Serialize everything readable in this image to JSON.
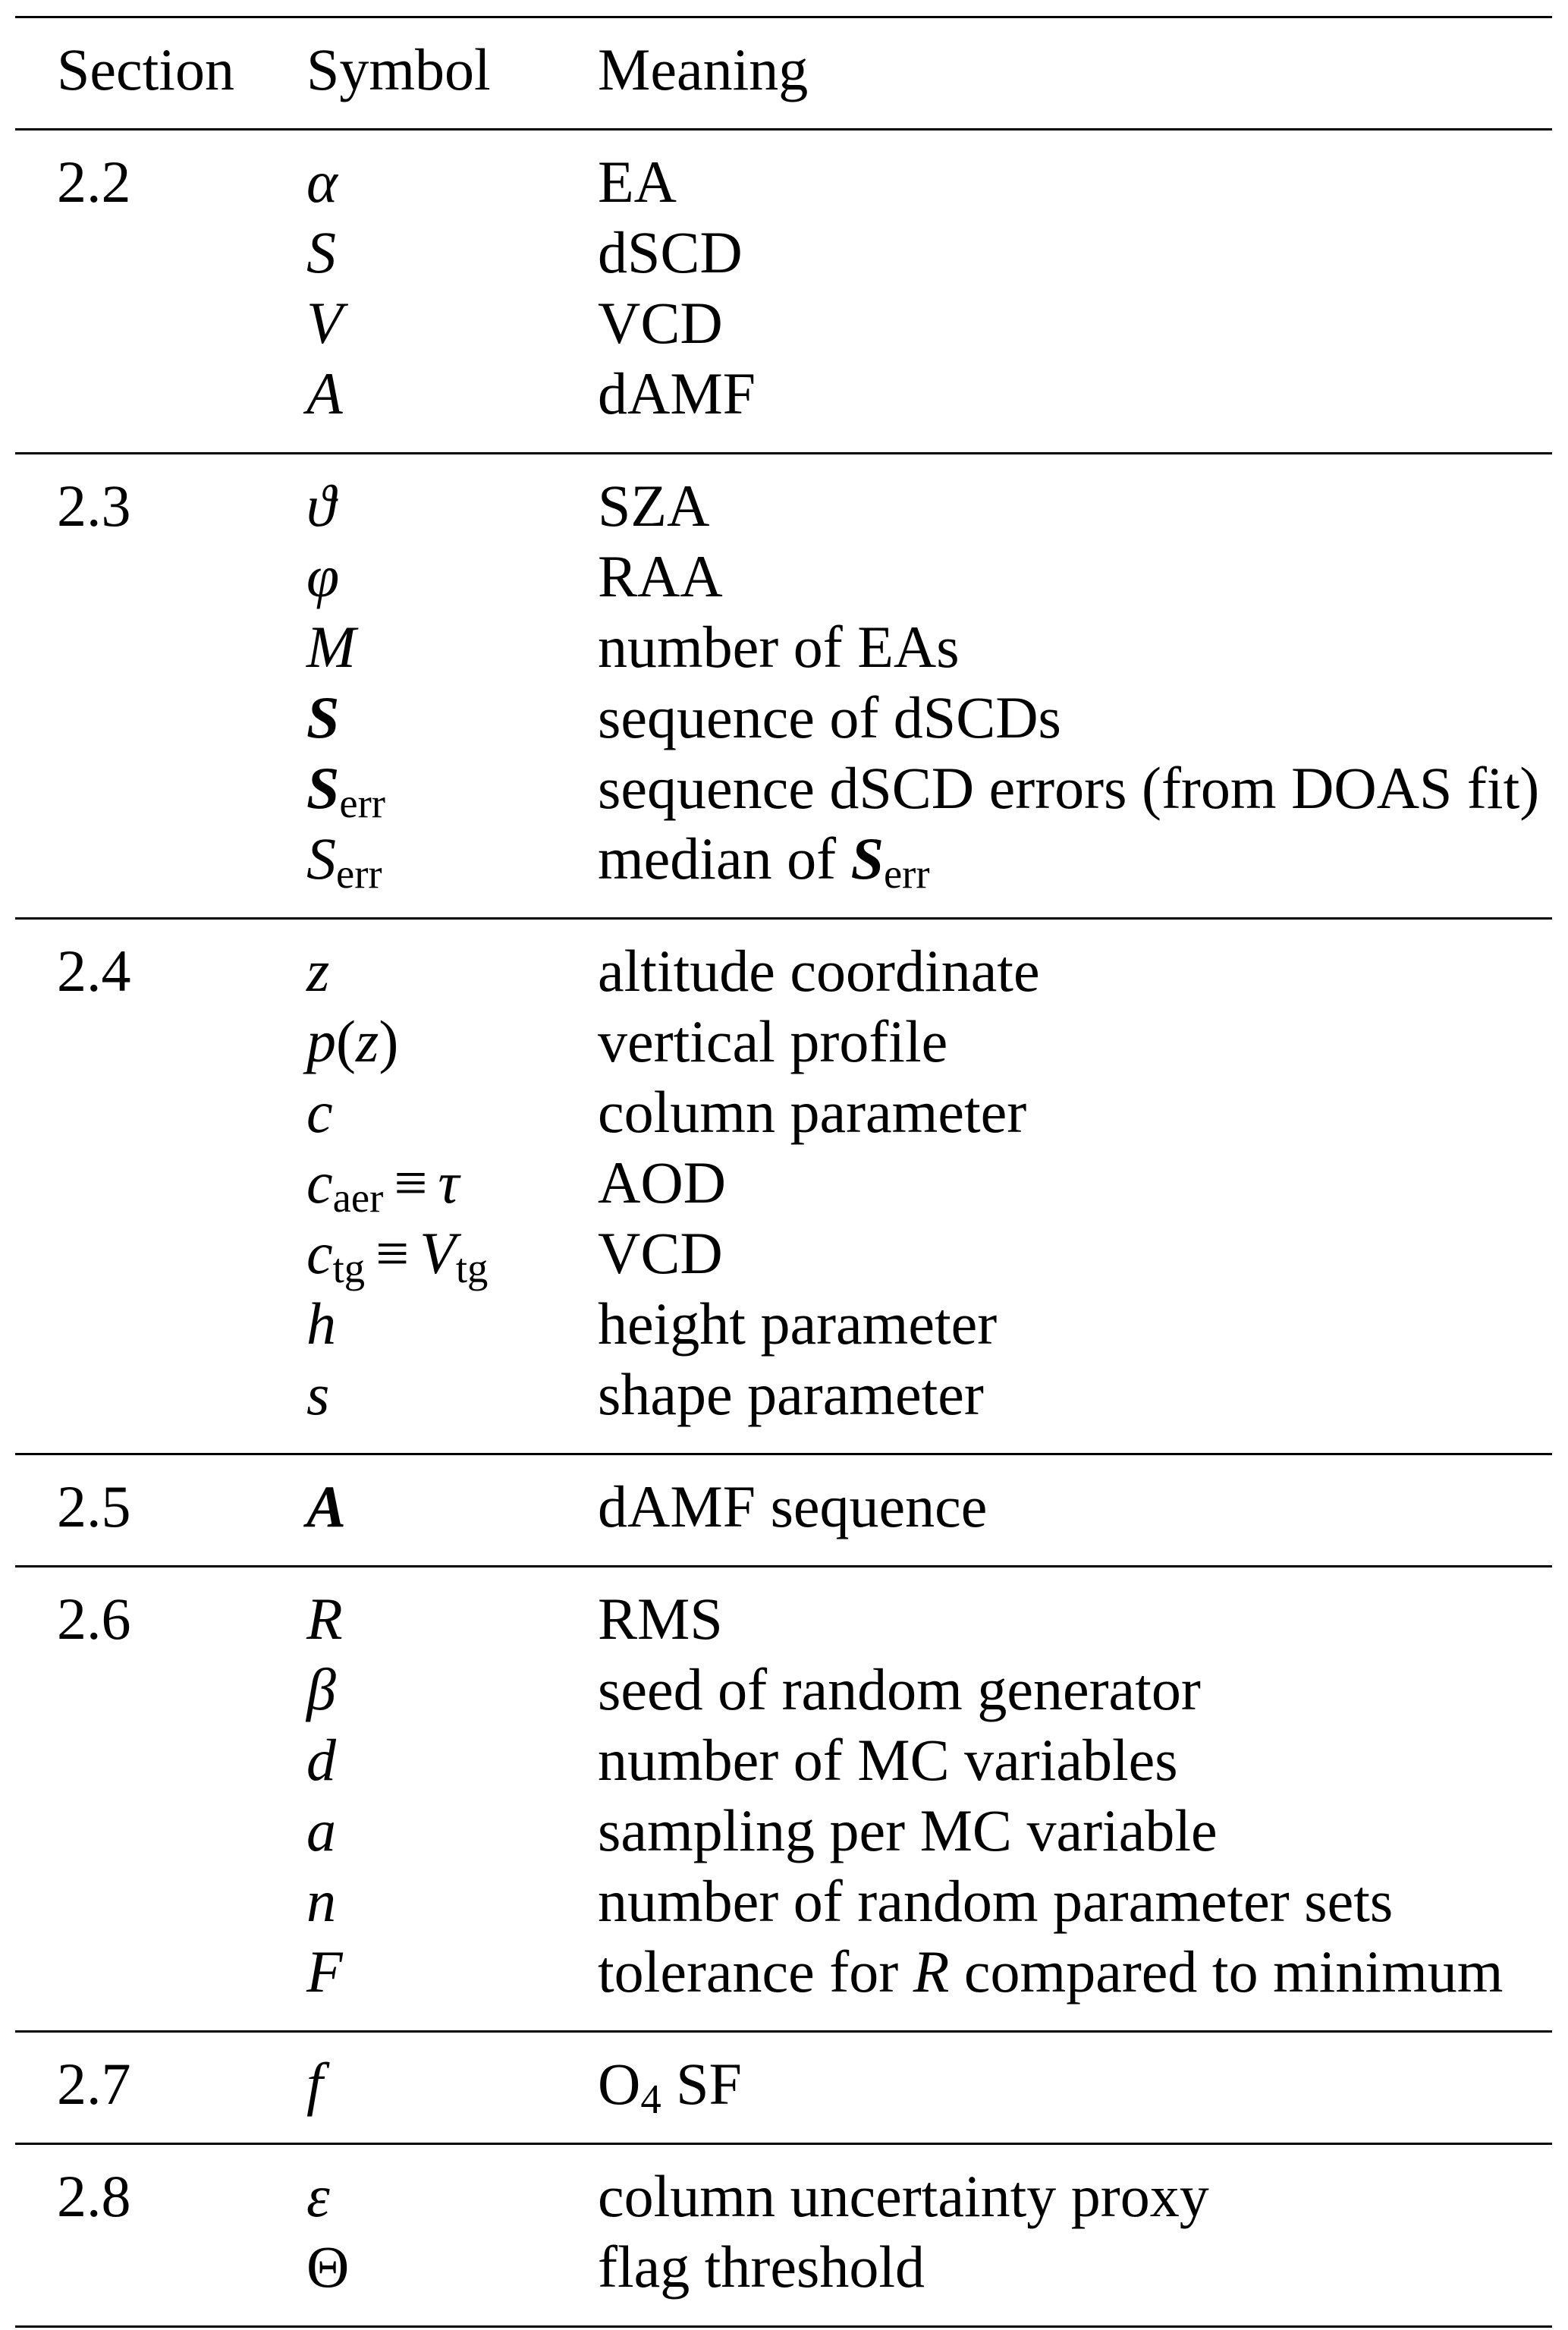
{
  "table": {
    "headers": {
      "section": "Section",
      "symbol": "Symbol",
      "meaning": "Meaning"
    },
    "sections": [
      {
        "section": "2.2",
        "rows": [
          {
            "symbol": [
              {
                "t": "α",
                "s": "it"
              }
            ],
            "meaning": [
              {
                "t": "EA"
              }
            ]
          },
          {
            "symbol": [
              {
                "t": "S",
                "s": "it"
              }
            ],
            "meaning": [
              {
                "t": "dSCD"
              }
            ]
          },
          {
            "symbol": [
              {
                "t": "V",
                "s": "it"
              }
            ],
            "meaning": [
              {
                "t": "VCD"
              }
            ]
          },
          {
            "symbol": [
              {
                "t": "A",
                "s": "it"
              }
            ],
            "meaning": [
              {
                "t": "dAMF"
              }
            ]
          }
        ]
      },
      {
        "section": "2.3",
        "rows": [
          {
            "symbol": [
              {
                "t": "ϑ",
                "s": "it"
              }
            ],
            "meaning": [
              {
                "t": "SZA"
              }
            ]
          },
          {
            "symbol": [
              {
                "t": "φ",
                "s": "it"
              }
            ],
            "meaning": [
              {
                "t": "RAA"
              }
            ]
          },
          {
            "symbol": [
              {
                "t": "M",
                "s": "it"
              }
            ],
            "meaning": [
              {
                "t": "number of EAs"
              }
            ]
          },
          {
            "symbol": [
              {
                "t": "S",
                "s": "bi"
              }
            ],
            "meaning": [
              {
                "t": "sequence of dSCDs"
              }
            ]
          },
          {
            "symbol": [
              {
                "t": "S",
                "s": "bi"
              },
              {
                "t": "err",
                "s": "sub"
              }
            ],
            "meaning": [
              {
                "t": "sequence dSCD errors (from DOAS fit)"
              }
            ]
          },
          {
            "symbol": [
              {
                "t": "S",
                "s": "it"
              },
              {
                "t": "err",
                "s": "sub"
              }
            ],
            "meaning": [
              {
                "t": "median of "
              },
              {
                "t": "S",
                "s": "bi"
              },
              {
                "t": "err",
                "s": "sub"
              }
            ]
          }
        ]
      },
      {
        "section": "2.4",
        "rows": [
          {
            "symbol": [
              {
                "t": "z",
                "s": "it"
              }
            ],
            "meaning": [
              {
                "t": "altitude coordinate"
              }
            ]
          },
          {
            "symbol": [
              {
                "t": "p",
                "s": "it"
              },
              {
                "t": "("
              },
              {
                "t": "z",
                "s": "it"
              },
              {
                "t": ")"
              }
            ],
            "meaning": [
              {
                "t": "vertical profile"
              }
            ]
          },
          {
            "symbol": [
              {
                "t": "c",
                "s": "it"
              }
            ],
            "meaning": [
              {
                "t": "column parameter"
              }
            ]
          },
          {
            "symbol": [
              {
                "t": "c",
                "s": "it"
              },
              {
                "t": "aer",
                "s": "sub"
              },
              {
                "t": "≡",
                "s": "op"
              },
              {
                "t": "τ",
                "s": "it"
              }
            ],
            "meaning": [
              {
                "t": "AOD"
              }
            ]
          },
          {
            "symbol": [
              {
                "t": "c",
                "s": "it"
              },
              {
                "t": "tg",
                "s": "sub"
              },
              {
                "t": "≡",
                "s": "op"
              },
              {
                "t": "V",
                "s": "it"
              },
              {
                "t": "tg",
                "s": "sub"
              }
            ],
            "meaning": [
              {
                "t": "VCD"
              }
            ]
          },
          {
            "symbol": [
              {
                "t": "h",
                "s": "it"
              }
            ],
            "meaning": [
              {
                "t": "height parameter"
              }
            ]
          },
          {
            "symbol": [
              {
                "t": "s",
                "s": "it"
              }
            ],
            "meaning": [
              {
                "t": "shape parameter"
              }
            ]
          }
        ]
      },
      {
        "section": "2.5",
        "rows": [
          {
            "symbol": [
              {
                "t": "A",
                "s": "bi"
              }
            ],
            "meaning": [
              {
                "t": "dAMF sequence"
              }
            ]
          }
        ]
      },
      {
        "section": "2.6",
        "rows": [
          {
            "symbol": [
              {
                "t": "R",
                "s": "it"
              }
            ],
            "meaning": [
              {
                "t": "RMS"
              }
            ]
          },
          {
            "symbol": [
              {
                "t": "β",
                "s": "it"
              }
            ],
            "meaning": [
              {
                "t": "seed of random generator"
              }
            ]
          },
          {
            "symbol": [
              {
                "t": "d",
                "s": "it"
              }
            ],
            "meaning": [
              {
                "t": "number of MC variables"
              }
            ]
          },
          {
            "symbol": [
              {
                "t": "a",
                "s": "it"
              }
            ],
            "meaning": [
              {
                "t": "sampling per MC variable"
              }
            ]
          },
          {
            "symbol": [
              {
                "t": "n",
                "s": "it"
              }
            ],
            "meaning": [
              {
                "t": "number of random parameter sets"
              }
            ]
          },
          {
            "symbol": [
              {
                "t": "F",
                "s": "it"
              }
            ],
            "meaning": [
              {
                "t": "tolerance for "
              },
              {
                "t": "R",
                "s": "it"
              },
              {
                "t": " compared to minimum"
              }
            ]
          }
        ]
      },
      {
        "section": "2.7",
        "rows": [
          {
            "symbol": [
              {
                "t": "f",
                "s": "it"
              }
            ],
            "meaning": [
              {
                "t": "O"
              },
              {
                "t": "4",
                "s": "sub"
              },
              {
                "t": " SF"
              }
            ]
          }
        ]
      },
      {
        "section": "2.8",
        "rows": [
          {
            "symbol": [
              {
                "t": "ε",
                "s": "it"
              }
            ],
            "meaning": [
              {
                "t": "column uncertainty proxy"
              }
            ]
          },
          {
            "symbol": [
              {
                "t": "Θ"
              }
            ],
            "meaning": [
              {
                "t": "flag threshold"
              }
            ]
          }
        ]
      }
    ]
  }
}
